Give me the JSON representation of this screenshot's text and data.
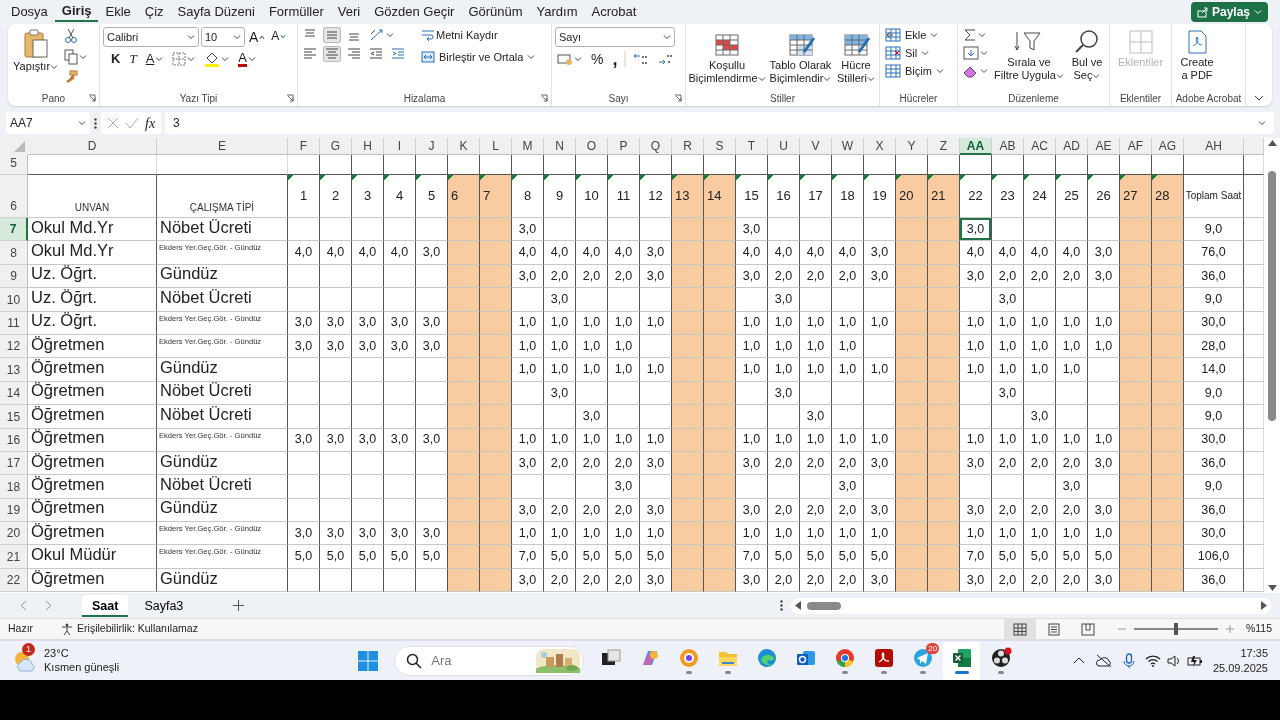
{
  "menu_tabs": [
    {
      "label": "Dosya",
      "selected": false
    },
    {
      "label": "Giriş",
      "selected": true
    },
    {
      "label": "Ekle",
      "selected": false
    },
    {
      "label": "Çiz",
      "selected": false
    },
    {
      "label": "Sayfa Düzeni",
      "selected": false
    },
    {
      "label": "Formüller",
      "selected": false
    },
    {
      "label": "Veri",
      "selected": false
    },
    {
      "label": "Gözden Geçir",
      "selected": false
    },
    {
      "label": "Görünüm",
      "selected": false
    },
    {
      "label": "Yardım",
      "selected": false
    },
    {
      "label": "Acrobat",
      "selected": false
    }
  ],
  "share_button": "Paylaş",
  "ribbon": {
    "clipboard": {
      "label": "Pano",
      "paste": "Yapıştır"
    },
    "font": {
      "label": "Yazı Tipi",
      "font_name": "Calibri",
      "font_size": "10",
      "grow": "A",
      "shrink": "A",
      "bold": "K",
      "italic": "T",
      "underline": "A",
      "font_color": "A"
    },
    "alignment": {
      "label": "Hizalama",
      "vertical": [
        {
          "selected": false
        },
        {
          "selected": true
        },
        {
          "selected": false
        }
      ],
      "horizontal": [
        {
          "selected": false
        },
        {
          "selected": true
        },
        {
          "selected": false
        }
      ],
      "wrap_text": "Metni Kaydır",
      "merge_center": "Birleştir ve Ortala"
    },
    "number": {
      "label": "Sayı",
      "format": "Sayı",
      "percent": "%",
      "comma": ","
    },
    "styles": {
      "label": "Stiller",
      "conditional": "Koşullu Biçimlendirme",
      "table": "Tablo Olarak Biçimlendir",
      "cell_styles": "Hücre Stilleri"
    },
    "cells": {
      "label": "Hücreler",
      "insert": "Ekle",
      "delete": "Sil",
      "format": "Biçim"
    },
    "editing": {
      "label": "Düzenleme",
      "sort_filter": "Sırala ve Filtre Uygula",
      "find_select": "Bul ve Seç"
    },
    "addins": {
      "label": "Eklentiler",
      "button": "Eklentiler",
      "disabled": true
    },
    "acrobat": {
      "label": "Adobe Acrobat",
      "button": "Create a PDF"
    }
  },
  "formula_bar": {
    "name_box": "AA7",
    "function_label": "fx",
    "formula": "3"
  },
  "sheet": {
    "header_rows": [
      "5",
      "6"
    ],
    "columns": [
      {
        "kind": "text",
        "label": "D",
        "heading": "UNVAN",
        "selected": false
      },
      {
        "kind": "text",
        "label": "E",
        "heading": "ÇALIŞMA TİPİ",
        "selected": false
      },
      {
        "kind": "day",
        "label": "F",
        "day": "1",
        "weekend": false,
        "selected": false
      },
      {
        "kind": "day",
        "label": "G",
        "day": "2",
        "weekend": false,
        "selected": false
      },
      {
        "kind": "day",
        "label": "H",
        "day": "3",
        "weekend": false,
        "selected": false
      },
      {
        "kind": "day",
        "label": "I",
        "day": "4",
        "weekend": false,
        "selected": false
      },
      {
        "kind": "day",
        "label": "J",
        "day": "5",
        "weekend": false,
        "selected": false
      },
      {
        "kind": "day",
        "label": "K",
        "day": "6",
        "weekend": true,
        "selected": false
      },
      {
        "kind": "day",
        "label": "L",
        "day": "7",
        "weekend": true,
        "selected": false
      },
      {
        "kind": "day",
        "label": "M",
        "day": "8",
        "weekend": false,
        "selected": false
      },
      {
        "kind": "day",
        "label": "N",
        "day": "9",
        "weekend": false,
        "selected": false
      },
      {
        "kind": "day",
        "label": "O",
        "day": "10",
        "weekend": false,
        "selected": false
      },
      {
        "kind": "day",
        "label": "P",
        "day": "11",
        "weekend": false,
        "selected": false
      },
      {
        "kind": "day",
        "label": "Q",
        "day": "12",
        "weekend": false,
        "selected": false
      },
      {
        "kind": "day",
        "label": "R",
        "day": "13",
        "weekend": true,
        "selected": false
      },
      {
        "kind": "day",
        "label": "S",
        "day": "14",
        "weekend": true,
        "selected": false
      },
      {
        "kind": "day",
        "label": "T",
        "day": "15",
        "weekend": false,
        "selected": false
      },
      {
        "kind": "day",
        "label": "U",
        "day": "16",
        "weekend": false,
        "selected": false
      },
      {
        "kind": "day",
        "label": "V",
        "day": "17",
        "weekend": false,
        "selected": false
      },
      {
        "kind": "day",
        "label": "W",
        "day": "18",
        "weekend": false,
        "selected": false
      },
      {
        "kind": "day",
        "label": "X",
        "day": "19",
        "weekend": false,
        "selected": false
      },
      {
        "kind": "day",
        "label": "Y",
        "day": "20",
        "weekend": true,
        "selected": false
      },
      {
        "kind": "day",
        "label": "Z",
        "day": "21",
        "weekend": true,
        "selected": false
      },
      {
        "kind": "day",
        "label": "AA",
        "day": "22",
        "weekend": false,
        "selected": true
      },
      {
        "kind": "day",
        "label": "AB",
        "day": "23",
        "weekend": false,
        "selected": false
      },
      {
        "kind": "day",
        "label": "AC",
        "day": "24",
        "weekend": false,
        "selected": false
      },
      {
        "kind": "day",
        "label": "AD",
        "day": "25",
        "weekend": false,
        "selected": false
      },
      {
        "kind": "day",
        "label": "AE",
        "day": "26",
        "weekend": false,
        "selected": false
      },
      {
        "kind": "day",
        "label": "AF",
        "day": "27",
        "weekend": true,
        "selected": false
      },
      {
        "kind": "day",
        "label": "AG",
        "day": "28",
        "weekend": true,
        "selected": false
      },
      {
        "kind": "total",
        "label": "AH",
        "heading": "Toplam Saat",
        "selected": false
      }
    ],
    "rows": [
      {
        "number": "7",
        "selected": true,
        "title": "Okul Md.Yr",
        "type": "Nöbet Ücreti",
        "type_shrunk": false,
        "total": "9,0",
        "days": {
          "d8": "3,0",
          "d15": "3,0",
          "d22": "3,0"
        }
      },
      {
        "number": "8",
        "selected": false,
        "title": "Okul Md.Yr",
        "type": "Ekders Yer.Geç.Gör. - Gündüz",
        "type_shrunk": true,
        "total": "76,0",
        "days": {
          "d1": "4,0",
          "d2": "4,0",
          "d3": "4,0",
          "d4": "4,0",
          "d5": "3,0",
          "d8": "4,0",
          "d9": "4,0",
          "d10": "4,0",
          "d11": "4,0",
          "d12": "3,0",
          "d15": "4,0",
          "d16": "4,0",
          "d17": "4,0",
          "d18": "4,0",
          "d19": "3,0",
          "d22": "4,0",
          "d23": "4,0",
          "d24": "4,0",
          "d25": "4,0",
          "d26": "3,0"
        }
      },
      {
        "number": "9",
        "selected": false,
        "title": "Uz. Öğrt.",
        "type": "Gündüz",
        "type_shrunk": false,
        "total": "36,0",
        "days": {
          "d8": "3,0",
          "d9": "2,0",
          "d10": "2,0",
          "d11": "2,0",
          "d12": "3,0",
          "d15": "3,0",
          "d16": "2,0",
          "d17": "2,0",
          "d18": "2,0",
          "d19": "3,0",
          "d22": "3,0",
          "d23": "2,0",
          "d24": "2,0",
          "d25": "2,0",
          "d26": "3,0"
        }
      },
      {
        "number": "10",
        "selected": false,
        "title": "Uz. Öğrt.",
        "type": "Nöbet Ücreti",
        "type_shrunk": false,
        "total": "9,0",
        "days": {
          "d9": "3,0",
          "d16": "3,0",
          "d23": "3,0"
        }
      },
      {
        "number": "11",
        "selected": false,
        "title": "Uz. Öğrt.",
        "type": "Ekders Yer.Geç.Gör. - Gündüz",
        "type_shrunk": true,
        "total": "30,0",
        "days": {
          "d1": "3,0",
          "d2": "3,0",
          "d3": "3,0",
          "d4": "3,0",
          "d5": "3,0",
          "d8": "1,0",
          "d9": "1,0",
          "d10": "1,0",
          "d11": "1,0",
          "d12": "1,0",
          "d15": "1,0",
          "d16": "1,0",
          "d17": "1,0",
          "d18": "1,0",
          "d19": "1,0",
          "d22": "1,0",
          "d23": "1,0",
          "d24": "1,0",
          "d25": "1,0",
          "d26": "1,0"
        }
      },
      {
        "number": "12",
        "selected": false,
        "title": "Öğretmen",
        "type": "Ekders Yer.Geç.Gör. - Gündüz",
        "type_shrunk": true,
        "total": "28,0",
        "days": {
          "d1": "3,0",
          "d2": "3,0",
          "d3": "3,0",
          "d4": "3,0",
          "d5": "3,0",
          "d8": "1,0",
          "d9": "1,0",
          "d10": "1,0",
          "d11": "1,0",
          "d15": "1,0",
          "d16": "1,0",
          "d17": "1,0",
          "d18": "1,0",
          "d22": "1,0",
          "d23": "1,0",
          "d24": "1,0",
          "d25": "1,0",
          "d26": "1,0"
        }
      },
      {
        "number": "13",
        "selected": false,
        "title": "Öğretmen",
        "type": "Gündüz",
        "type_shrunk": false,
        "total": "14,0",
        "days": {
          "d8": "1,0",
          "d9": "1,0",
          "d10": "1,0",
          "d11": "1,0",
          "d12": "1,0",
          "d15": "1,0",
          "d16": "1,0",
          "d17": "1,0",
          "d18": "1,0",
          "d19": "1,0",
          "d22": "1,0",
          "d23": "1,0",
          "d24": "1,0",
          "d25": "1,0"
        }
      },
      {
        "number": "14",
        "selected": false,
        "title": "Öğretmen",
        "type": "Nöbet Ücreti",
        "type_shrunk": false,
        "total": "9,0",
        "days": {
          "d9": "3,0",
          "d16": "3,0",
          "d23": "3,0"
        }
      },
      {
        "number": "15",
        "selected": false,
        "title": "Öğretmen",
        "type": "Nöbet Ücreti",
        "type_shrunk": false,
        "total": "9,0",
        "days": {
          "d10": "3,0",
          "d17": "3,0",
          "d24": "3,0"
        }
      },
      {
        "number": "16",
        "selected": false,
        "title": "Öğretmen",
        "type": "Ekders Yer.Geç.Gör. - Gündüz",
        "type_shrunk": true,
        "total": "30,0",
        "days": {
          "d1": "3,0",
          "d2": "3,0",
          "d3": "3,0",
          "d4": "3,0",
          "d5": "3,0",
          "d8": "1,0",
          "d9": "1,0",
          "d10": "1,0",
          "d11": "1,0",
          "d12": "1,0",
          "d15": "1,0",
          "d16": "1,0",
          "d17": "1,0",
          "d18": "1,0",
          "d19": "1,0",
          "d22": "1,0",
          "d23": "1,0",
          "d24": "1,0",
          "d25": "1,0",
          "d26": "1,0"
        }
      },
      {
        "number": "17",
        "selected": false,
        "title": "Öğretmen",
        "type": "Gündüz",
        "type_shrunk": false,
        "total": "36,0",
        "days": {
          "d8": "3,0",
          "d9": "2,0",
          "d10": "2,0",
          "d11": "2,0",
          "d12": "3,0",
          "d15": "3,0",
          "d16": "2,0",
          "d17": "2,0",
          "d18": "2,0",
          "d19": "3,0",
          "d22": "3,0",
          "d23": "2,0",
          "d24": "2,0",
          "d25": "2,0",
          "d26": "3,0"
        }
      },
      {
        "number": "18",
        "selected": false,
        "title": "Öğretmen",
        "type": "Nöbet Ücreti",
        "type_shrunk": false,
        "total": "9,0",
        "days": {
          "d11": "3,0",
          "d18": "3,0",
          "d25": "3,0"
        }
      },
      {
        "number": "19",
        "selected": false,
        "title": "Öğretmen",
        "type": "Gündüz",
        "type_shrunk": false,
        "total": "36,0",
        "days": {
          "d8": "3,0",
          "d9": "2,0",
          "d10": "2,0",
          "d11": "2,0",
          "d12": "3,0",
          "d15": "3,0",
          "d16": "2,0",
          "d17": "2,0",
          "d18": "2,0",
          "d19": "3,0",
          "d22": "3,0",
          "d23": "2,0",
          "d24": "2,0",
          "d25": "2,0",
          "d26": "3,0"
        }
      },
      {
        "number": "20",
        "selected": false,
        "title": "Öğretmen",
        "type": "Ekders Yer.Geç.Gör. - Gündüz",
        "type_shrunk": true,
        "total": "30,0",
        "days": {
          "d1": "3,0",
          "d2": "3,0",
          "d3": "3,0",
          "d4": "3,0",
          "d5": "3,0",
          "d8": "1,0",
          "d9": "1,0",
          "d10": "1,0",
          "d11": "1,0",
          "d12": "1,0",
          "d15": "1,0",
          "d16": "1,0",
          "d17": "1,0",
          "d18": "1,0",
          "d19": "1,0",
          "d22": "1,0",
          "d23": "1,0",
          "d24": "1,0",
          "d25": "1,0",
          "d26": "1,0"
        }
      },
      {
        "number": "21",
        "selected": false,
        "title": "Okul Müdür",
        "type": "Ekders Yer.Geç.Gör. - Gündüz",
        "type_shrunk": true,
        "total": "106,0",
        "days": {
          "d1": "5,0",
          "d2": "5,0",
          "d3": "5,0",
          "d4": "5,0",
          "d5": "5,0",
          "d8": "7,0",
          "d9": "5,0",
          "d10": "5,0",
          "d11": "5,0",
          "d12": "5,0",
          "d15": "7,0",
          "d16": "5,0",
          "d17": "5,0",
          "d18": "5,0",
          "d19": "5,0",
          "d22": "7,0",
          "d23": "5,0",
          "d24": "5,0",
          "d25": "5,0",
          "d26": "5,0"
        }
      },
      {
        "number": "22",
        "selected": false,
        "title": "Öğretmen",
        "type": "Gündüz",
        "type_shrunk": false,
        "total": "36,0",
        "days": {
          "d8": "3,0",
          "d9": "2,0",
          "d10": "2,0",
          "d11": "2,0",
          "d12": "3,0",
          "d15": "3,0",
          "d16": "2,0",
          "d17": "2,0",
          "d18": "2,0",
          "d19": "3,0",
          "d22": "3,0",
          "d23": "2,0",
          "d24": "2,0",
          "d25": "2,0",
          "d26": "3,0"
        }
      }
    ]
  },
  "sheet_tabs": [
    {
      "label": "Saat",
      "selected": true
    },
    {
      "label": "Sayfa3",
      "selected": false
    }
  ],
  "status_bar": {
    "ready": "Hazır",
    "accessibility": "Erişilebilirlik: Kullanılamaz",
    "views": [
      {
        "selected": true
      },
      {
        "selected": false
      },
      {
        "selected": false
      }
    ],
    "zoom_slider": {
      "level": 0.5
    },
    "zoom": "%115"
  },
  "taskbar": {
    "weather": {
      "badge": "1",
      "temperature": "23°C",
      "condition": "Kısmen güneşli"
    },
    "search_placeholder": "Ara",
    "apps": [
      {
        "kind": "taskview",
        "running": false
      },
      {
        "kind": "copilot",
        "running": false
      },
      {
        "kind": "ring",
        "running": true
      },
      {
        "kind": "folder",
        "running": true
      },
      {
        "kind": "edge",
        "running": false
      },
      {
        "kind": "mail",
        "running": false
      },
      {
        "kind": "chrome",
        "running": true
      },
      {
        "kind": "pdf",
        "running": true
      },
      {
        "kind": "telegram",
        "running": true,
        "badge": "20"
      },
      {
        "kind": "excel",
        "running": true,
        "active": true
      },
      {
        "kind": "obs",
        "running": true
      }
    ],
    "clock": {
      "time": "17:35",
      "date": "25.09.2025"
    }
  }
}
